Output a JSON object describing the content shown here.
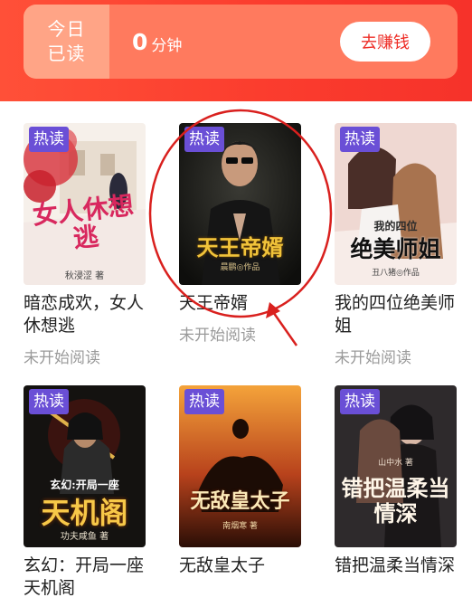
{
  "reading": {
    "label_line1": "今日",
    "label_line2": "已读",
    "minutes": "0",
    "unit": "分钟",
    "earn_button": "去赚钱"
  },
  "books": [
    {
      "title": "暗恋成欢，女人休想逃",
      "badge": "热读",
      "status": "未开始阅读",
      "cover_text": "女人休想逃",
      "cover_author": "秋浸涩 著"
    },
    {
      "title": "天王帝婿",
      "badge": "热读",
      "status": "未开始阅读",
      "cover_text": "天王帝婿",
      "cover_author": "晨鹏◎作品"
    },
    {
      "title": "我的四位绝美师姐",
      "badge": "热读",
      "status": "未开始阅读",
      "cover_text": "绝美师姐",
      "cover_subtext": "我的四位",
      "cover_author": "丑八猪◎作品"
    },
    {
      "title": "玄幻：开局一座天机阁",
      "badge": "热读",
      "status": "",
      "cover_text": "天机阁",
      "cover_subtext": "玄幻:开局一座",
      "cover_author": "功夫咸鱼 著"
    },
    {
      "title": "无敌皇太子",
      "badge": "热读",
      "status": "",
      "cover_text": "无敌皇太子",
      "cover_author": "南烟寒 著"
    },
    {
      "title": "错把温柔当情深",
      "badge": "热读",
      "status": "",
      "cover_text": "错把温柔当情深",
      "cover_author": "山中水 著"
    }
  ],
  "colors": {
    "header_red": "#f6322a",
    "badge_purple": "#6a4fd6",
    "annotation_red": "#d9201e"
  }
}
